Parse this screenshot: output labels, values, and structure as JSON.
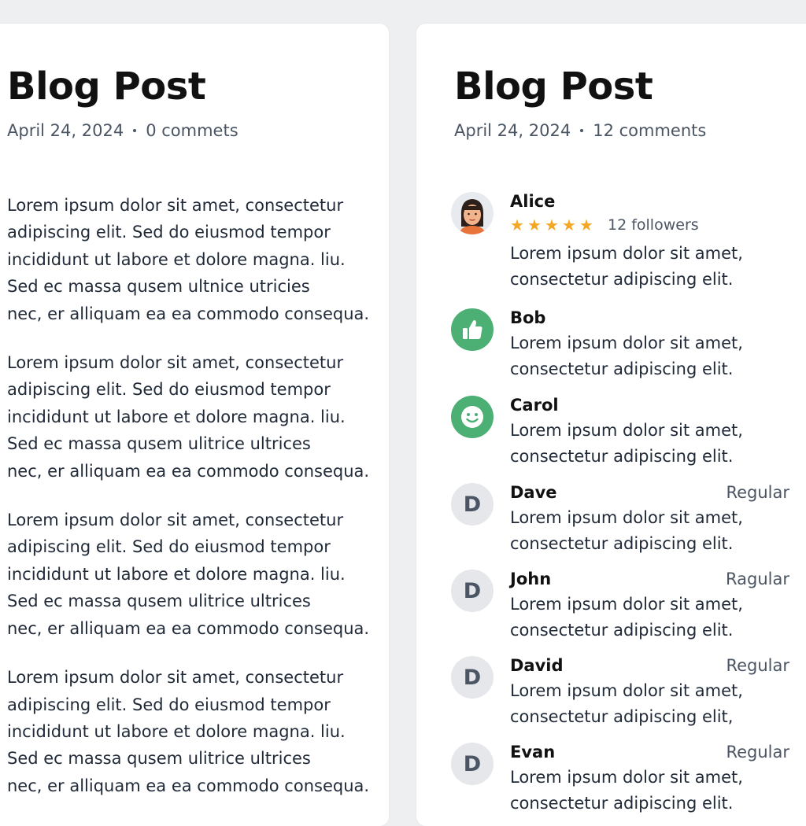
{
  "left_post": {
    "title": "Blog Post",
    "date": "April 24, 2024",
    "comments_label": "0 commets",
    "paragraphs": [
      [
        "Lorem ipsum dolor sit amet, consectetur",
        "adipiscing elit. Sed do eiusmod tempor",
        "incididunt ut labore et dolore magna. liu.",
        "Sed ec massa qusem ultnice utricies",
        "nec, er alliquam ea ea commodo consequa."
      ],
      [
        "Lorem ipsum dolor sit amet, consectetur",
        "adipiscing elit. Sed do eiusmod tempor",
        "incididunt ut labore et dolore magna. liu.",
        "Sed ec massa qusem ulitrice ultrices",
        "nec, er alliquam ea ea commodo consequa."
      ],
      [
        "Lorem ipsum dolor sit amet, consectetur",
        "adipiscing elit. Sed do eiusmod tempor",
        "incididunt ut labore et dolore magna. liu.",
        "Sed ec massa qusem ulitrice ultrices",
        "nec, er alliquam ea ea commodo consequa."
      ],
      [
        "Lorem ipsum dolor sit amet, consectetur",
        "adipiscing elit. Sed do eiusmod tempor",
        "incididunt ut labore et dolore magna. liu.",
        "Sed ec massa qusem ulitrice ultrices",
        "nec, er alliquam ea ea commodo consequa."
      ]
    ]
  },
  "right_post": {
    "title": "Blog Post",
    "date": "April 24, 2024",
    "comments_label": "12 comments",
    "comments": [
      {
        "name": "Alice",
        "avatar": "woman-avatar",
        "rating_stars": 5,
        "followers": "12 followers",
        "badge": "",
        "text": [
          "Lorem ipsum dolor sit amet,",
          "consectetur adipiscing elit."
        ]
      },
      {
        "name": "Bob",
        "avatar": "thumbs-up-icon",
        "badge": "",
        "text": [
          "Lorem ipsum dolor sit amet,",
          "consectetur adipiscing elit."
        ]
      },
      {
        "name": "Carol",
        "avatar": "smiley-icon",
        "badge": "",
        "text": [
          "Lorem ipsum dolor sit amet,",
          "consectetur adipiscing elit."
        ]
      },
      {
        "name": "Dave",
        "avatar_letter": "D",
        "badge": "Regular",
        "text": [
          "Lorem ipsum dolor sit amet,",
          "consectetur adipiscing elit."
        ]
      },
      {
        "name": "John",
        "avatar_letter": "D",
        "badge": "Ragular",
        "text": [
          "Lorem ipsum dolor sit amet,",
          "consectetur adipiscing elit."
        ]
      },
      {
        "name": "David",
        "avatar_letter": "D",
        "badge": "Regular",
        "text": [
          "Lorem ipsum dolor sit amet,",
          "consectetur adipiscing elit,"
        ]
      },
      {
        "name": "Evan",
        "avatar_letter": "D",
        "badge": "Regular",
        "text": [
          "Lorem ipsum dolor sit amet,",
          "consectetur adipiscing elit."
        ]
      }
    ]
  },
  "colors": {
    "background": "#eeeff0",
    "panel": "#ffffff",
    "accent_green": "#4caf73",
    "star": "#f5a623",
    "muted_text": "#4b5563"
  }
}
